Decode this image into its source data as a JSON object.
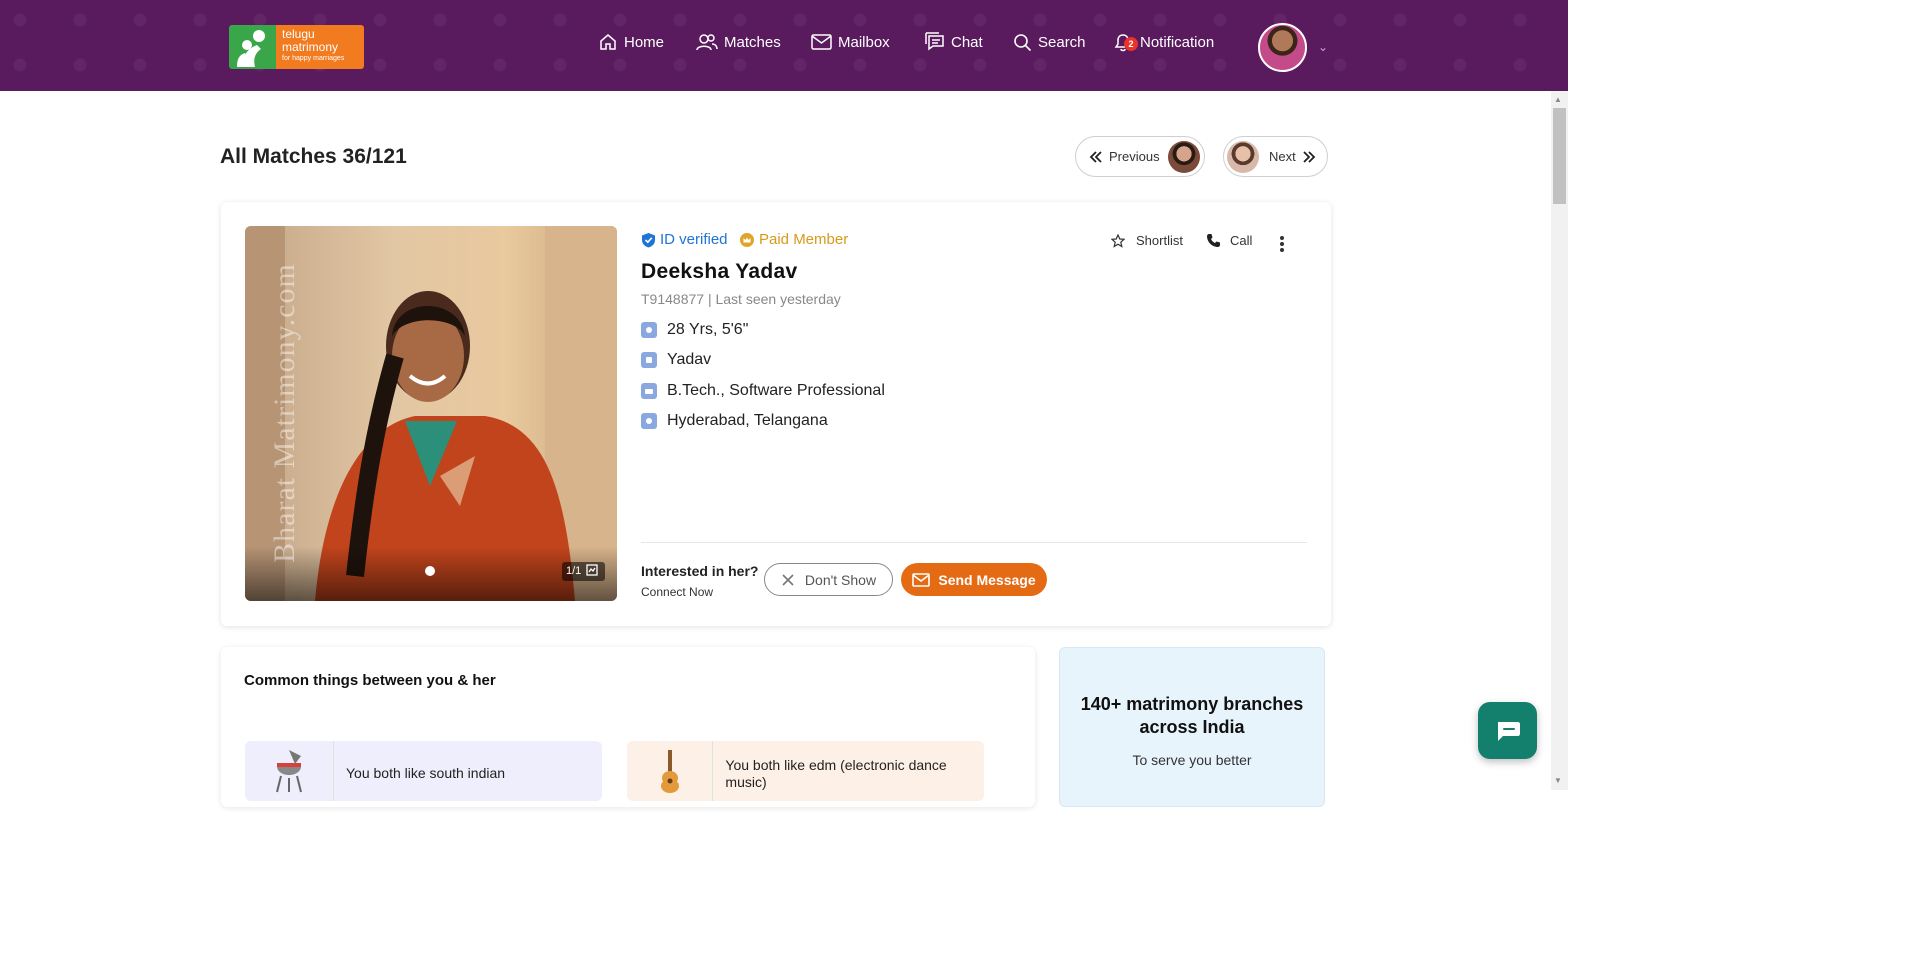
{
  "header": {
    "logo": {
      "line1": "telugu",
      "line2": "matrimony",
      "tagline": "for happy marriages"
    },
    "nav": [
      {
        "label": "Home",
        "icon": "home-icon"
      },
      {
        "label": "Matches",
        "icon": "users-icon"
      },
      {
        "label": "Mailbox",
        "icon": "mail-icon"
      },
      {
        "label": "Chat",
        "icon": "chat-icon"
      },
      {
        "label": "Search",
        "icon": "search-icon"
      },
      {
        "label": "Notification",
        "icon": "bell-icon",
        "badge": "2"
      }
    ]
  },
  "page": {
    "title": "All Matches 36/121",
    "previous_label": "Previous",
    "next_label": "Next"
  },
  "profile": {
    "id_verified": "ID verified",
    "paid_member": "Paid Member",
    "name": "Deeksha Yadav",
    "meta": "T9148877 | Last seen yesterday",
    "attributes": [
      {
        "icon": "age-icon",
        "text": "28 Yrs, 5'6\""
      },
      {
        "icon": "community-icon",
        "text": "Yadav"
      },
      {
        "icon": "education-icon",
        "text": "B.Tech., Software Professional"
      },
      {
        "icon": "location-icon",
        "text": "Hyderabad, Telangana"
      }
    ],
    "photo_counter": "1/1",
    "photo_watermark": "Bharat Matrimony.com",
    "actions": {
      "shortlist": "Shortlist",
      "call": "Call"
    },
    "interested": "Interested in her?",
    "connect": "Connect Now",
    "dont_show": "Don't Show",
    "send_message": "Send Message"
  },
  "common": {
    "title": "Common things between you & her",
    "items": [
      {
        "icon": "grill-icon",
        "text": "You both like south indian"
      },
      {
        "icon": "guitar-icon",
        "text": "You both like edm (electronic dance music)"
      }
    ]
  },
  "branches": {
    "title": "140+ matrimony branches across India",
    "subtitle": "To serve you better"
  },
  "colors": {
    "header_bg": "#5a1a5e",
    "accent_orange": "#e56a14",
    "verified_blue": "#1f74d6",
    "paid_gold": "#d89a1a"
  }
}
